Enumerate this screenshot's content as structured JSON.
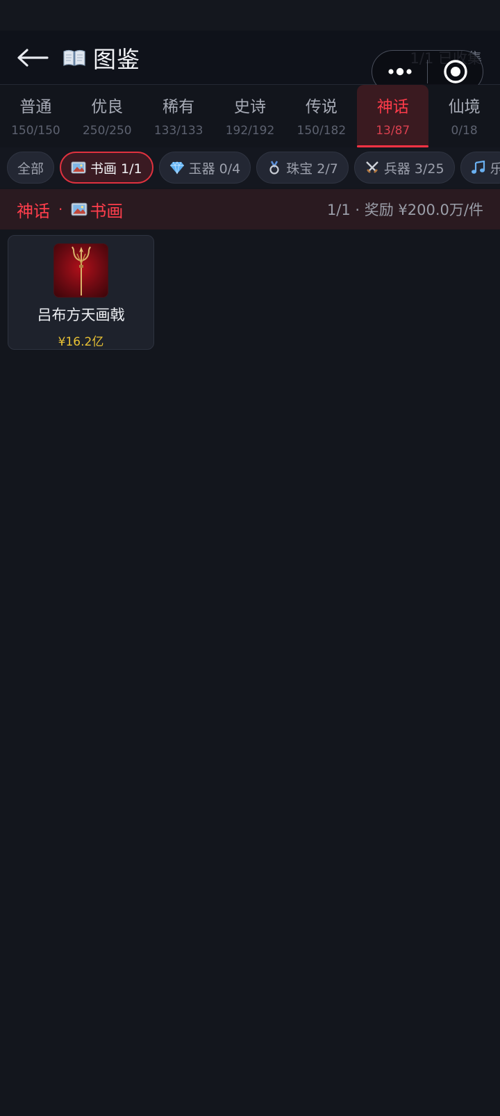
{
  "header": {
    "title": "图鉴",
    "collected": "1/1 已收集"
  },
  "tabs": [
    {
      "name": "普通",
      "count": "150/150"
    },
    {
      "name": "优良",
      "count": "250/250"
    },
    {
      "name": "稀有",
      "count": "133/133"
    },
    {
      "name": "史诗",
      "count": "192/192"
    },
    {
      "name": "传说",
      "count": "150/182"
    },
    {
      "name": "神话",
      "count": "13/87"
    },
    {
      "name": "仙境",
      "count": "0/18"
    }
  ],
  "active_tab": "神话",
  "chips": [
    {
      "label": "全部",
      "icon": ""
    },
    {
      "label": "书画 1/1",
      "icon": "painting-icon"
    },
    {
      "label": "玉器 0/4",
      "icon": "gem-icon"
    },
    {
      "label": "珠宝 2/7",
      "icon": "medal-icon"
    },
    {
      "label": "兵器 3/25",
      "icon": "crossed-swords-icon"
    },
    {
      "label": "乐",
      "icon": "music-note-icon"
    }
  ],
  "active_chip": "书画 1/1",
  "section": {
    "rarity": "神话",
    "separator": "·",
    "category": "书画",
    "summary": "1/1 · 奖励 ¥200.0万/件"
  },
  "items": [
    {
      "name": "吕布方天画戟",
      "price": "¥16.2亿",
      "icon": "halberd-icon"
    }
  ],
  "colors": {
    "accent": "#ff3b4a",
    "price": "#e9c234",
    "background": "#13161d"
  }
}
